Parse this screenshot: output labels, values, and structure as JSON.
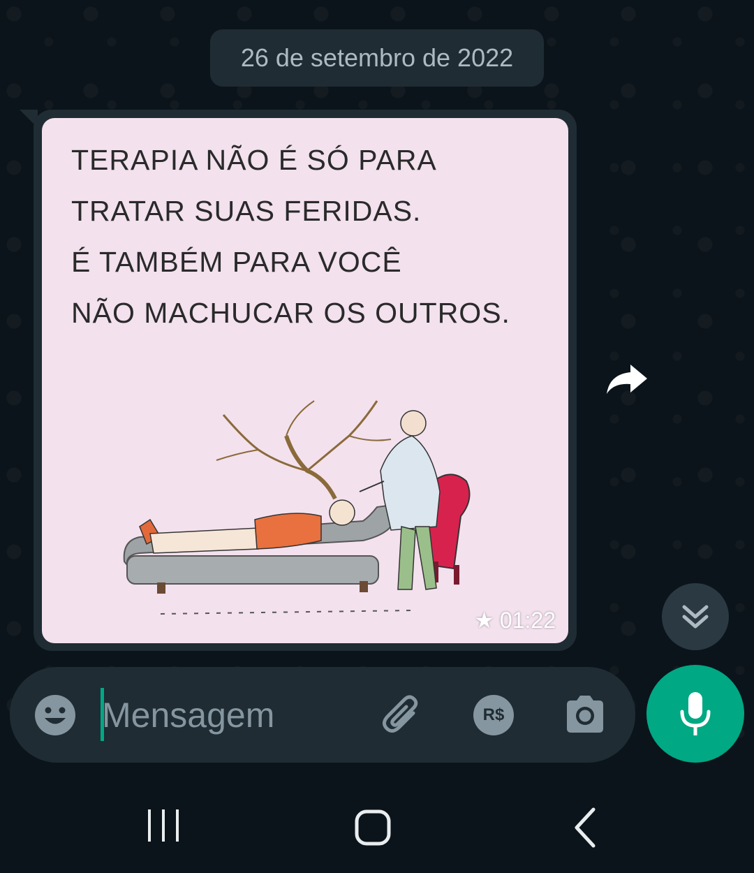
{
  "date_separator": "26 de setembro de 2022",
  "message": {
    "image_caption_lines": [
      "TERAPIA NÃO É SÓ PARA",
      "TRATAR SUAS FERIDAS.",
      "É TAMBÉM PARA VOCÊ",
      "NÃO MACHUCAR OS OUTROS."
    ],
    "starred": true,
    "time": "01:22"
  },
  "composer": {
    "placeholder": "Mensagem",
    "payment_label": "R$"
  },
  "icons": {
    "forward": "forward-icon",
    "scroll_down": "double-chevron-down-icon",
    "emoji": "emoji-icon",
    "attach": "paperclip-icon",
    "payment": "payment-icon",
    "camera": "camera-icon",
    "mic": "mic-icon",
    "nav_recents": "recents-icon",
    "nav_home": "home-icon",
    "nav_back": "back-icon"
  },
  "colors": {
    "background": "#0b141a",
    "bubble": "#1f2c33",
    "accent": "#00a884",
    "muted_text": "#8696a0",
    "image_bg": "#f3e1ee"
  }
}
